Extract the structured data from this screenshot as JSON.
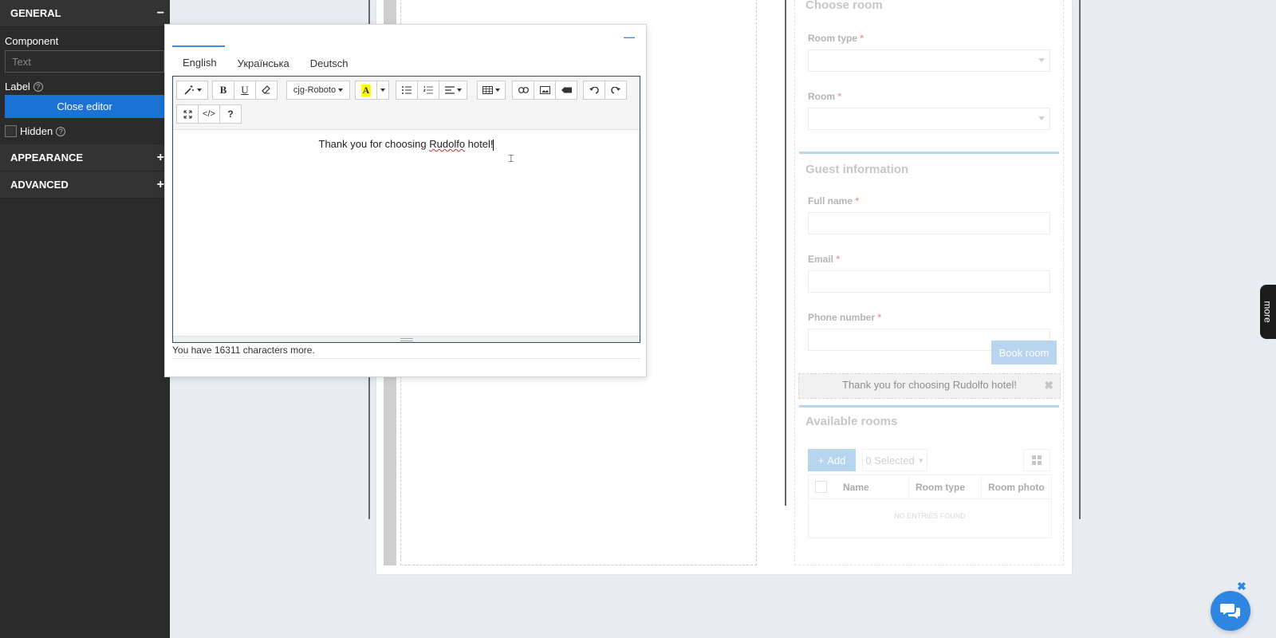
{
  "left_panel": {
    "general": {
      "title": "GENERAL",
      "toggle": "−"
    },
    "component": {
      "label": "Component",
      "value": "Text"
    },
    "label_field": {
      "label": "Label",
      "help": "?"
    },
    "close_editor": "Close editor",
    "hidden": {
      "label": "Hidden",
      "help": "?",
      "checked": false
    },
    "appearance": {
      "title": "APPEARANCE",
      "toggle": "+"
    },
    "advanced": {
      "title": "ADVANCED",
      "toggle": "+"
    }
  },
  "dialog": {
    "minimize": "—",
    "tabs": [
      "English",
      "Українська",
      "Deutsch"
    ],
    "active_tab": "English",
    "toolbar": {
      "magic": "magic-wand-icon",
      "bold": "B",
      "underline": "U",
      "eraser": "eraser-icon",
      "font": "cjg-Roboto",
      "color": "A",
      "ul": "unordered-list-icon",
      "ol": "ordered-list-icon",
      "align": "align-icon",
      "table": "table-icon",
      "link": "link-icon",
      "image": "image-icon",
      "video": "video-icon",
      "undo": "undo-icon",
      "redo": "redo-icon",
      "fullscreen": "fullscreen-icon",
      "code": "</>",
      "help": "?"
    },
    "content": {
      "before": "Thank you for choosing ",
      "misspelled": "Rudolfo",
      "after": " hotel!"
    },
    "char_count": "You have 16311 characters more."
  },
  "form": {
    "choose_room": "Choose room",
    "room_type_label": "Room type",
    "room_label": "Room",
    "required": "*",
    "guest_info": "Guest information",
    "full_name_label": "Full name",
    "email_label": "Email",
    "phone_label": "Phone number",
    "book_button": "Book room",
    "thank_you": "Thank you for choosing Rudolfo hotel!",
    "thank_close": "✖",
    "available_rooms": "Available rooms",
    "add_button": "Add",
    "selected_button": "0 Selected",
    "columns": [
      "Name",
      "Room type",
      "Room photo"
    ],
    "no_entries": "NO ENTRIES FOUND"
  },
  "side_tab": "more",
  "chat": {
    "close": "✖"
  },
  "colors": {
    "accent": "#1a73d4",
    "sidebar": "#2b2b2b",
    "form_accent": "#7fb3e2"
  }
}
